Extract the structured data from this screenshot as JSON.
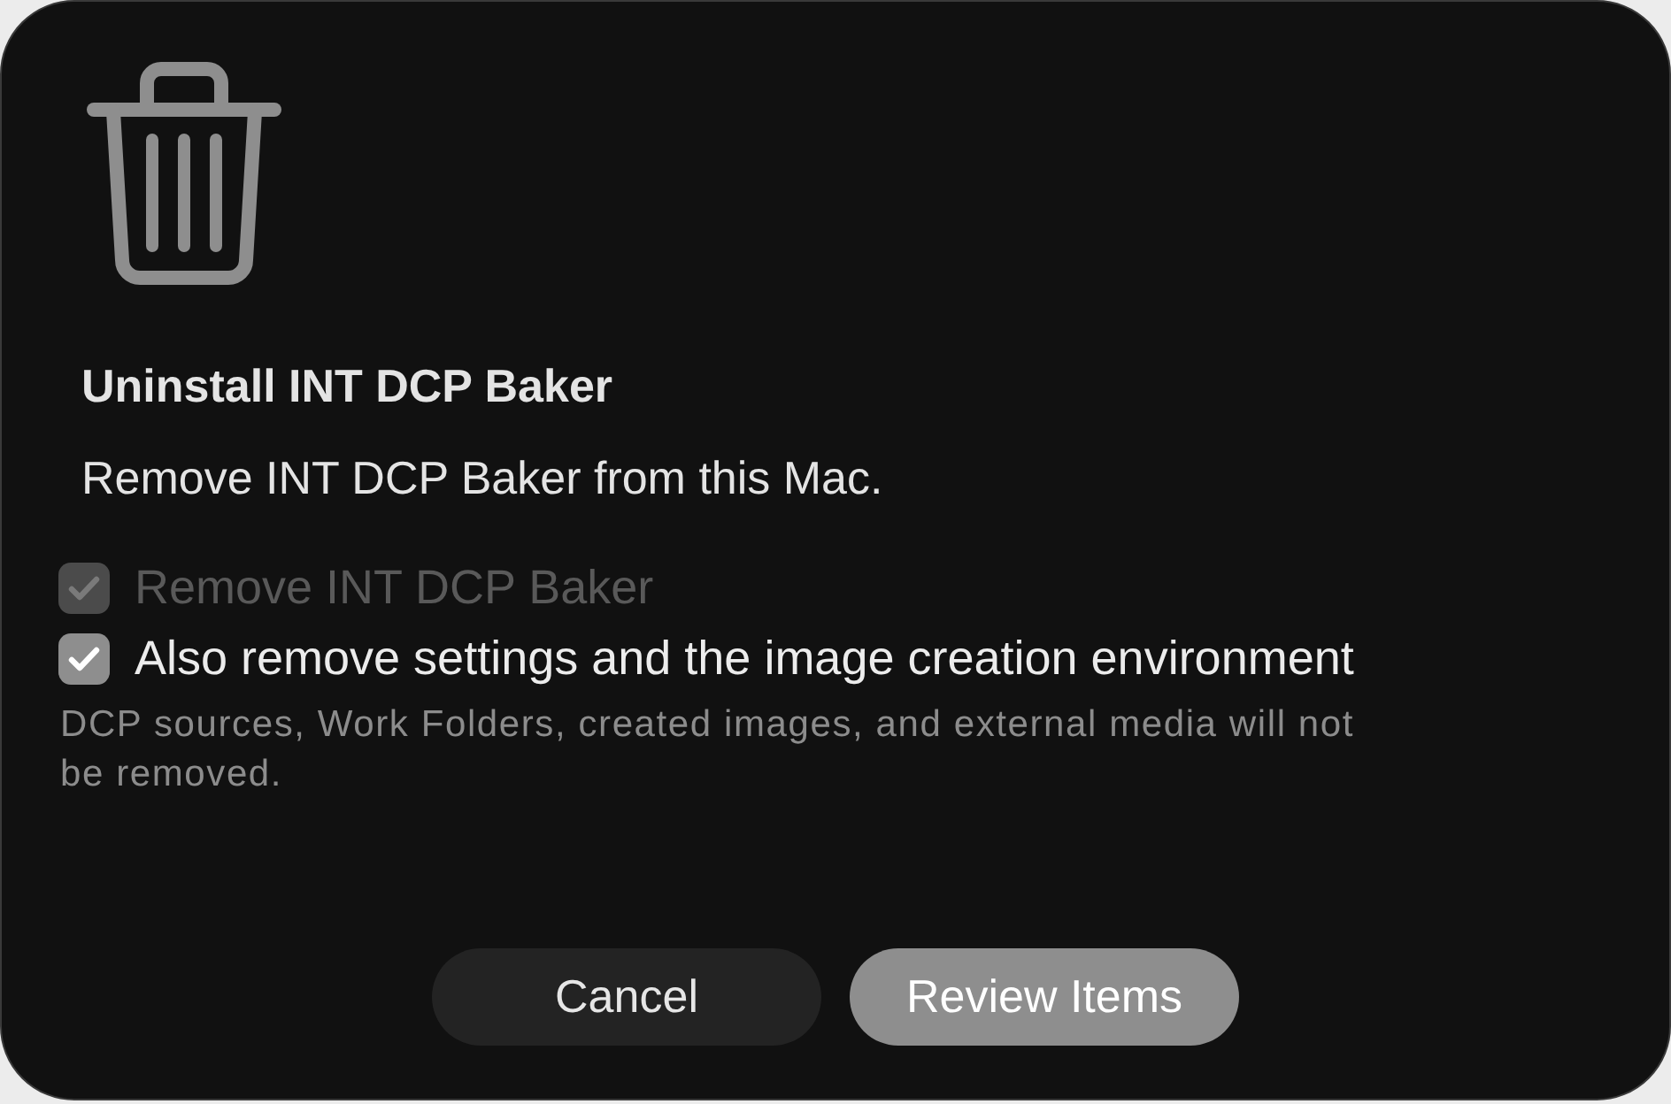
{
  "dialog": {
    "title": "Uninstall INT DCP Baker",
    "message": "Remove INT DCP Baker from this Mac.",
    "options": [
      {
        "label": "Remove INT DCP Baker",
        "checked": true,
        "disabled": true
      },
      {
        "label": "Also remove settings and the image creation environment",
        "checked": true,
        "disabled": false
      }
    ],
    "note": "DCP sources, Work Folders, created images, and external media will not be removed.",
    "buttons": [
      {
        "label": "Cancel",
        "kind": "secondary"
      },
      {
        "label": "Review Items",
        "kind": "primary"
      }
    ]
  }
}
